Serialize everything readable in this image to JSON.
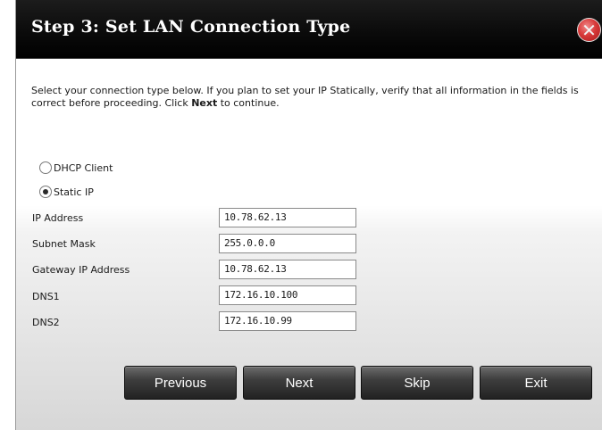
{
  "dialog": {
    "title": "Step 3: Set LAN Connection Type",
    "close_icon": "x-close-icon",
    "intro_before": "Select your connection type below. If you plan to set your IP Statically, verify that all information in the fields is correct before proceeding. Click ",
    "intro_bold": "Next",
    "intro_after": " to continue."
  },
  "connection_options": [
    {
      "label": "DHCP Client",
      "checked": false
    },
    {
      "label": "Static IP",
      "checked": true
    }
  ],
  "fields": [
    {
      "label": "IP Address",
      "value": "10.78.62.13"
    },
    {
      "label": "Subnet Mask",
      "value": "255.0.0.0"
    },
    {
      "label": "Gateway IP Address",
      "value": "10.78.62.13"
    },
    {
      "label": "DNS1",
      "value": "172.16.10.100"
    },
    {
      "label": "DNS2",
      "value": "172.16.10.99"
    }
  ],
  "buttons": {
    "previous": "Previous",
    "next": "Next",
    "skip": "Skip",
    "exit": "Exit"
  },
  "colors": {
    "title_bar": "#000000",
    "close_button": "#d83a3a",
    "button_face": "#3e3e3e"
  }
}
